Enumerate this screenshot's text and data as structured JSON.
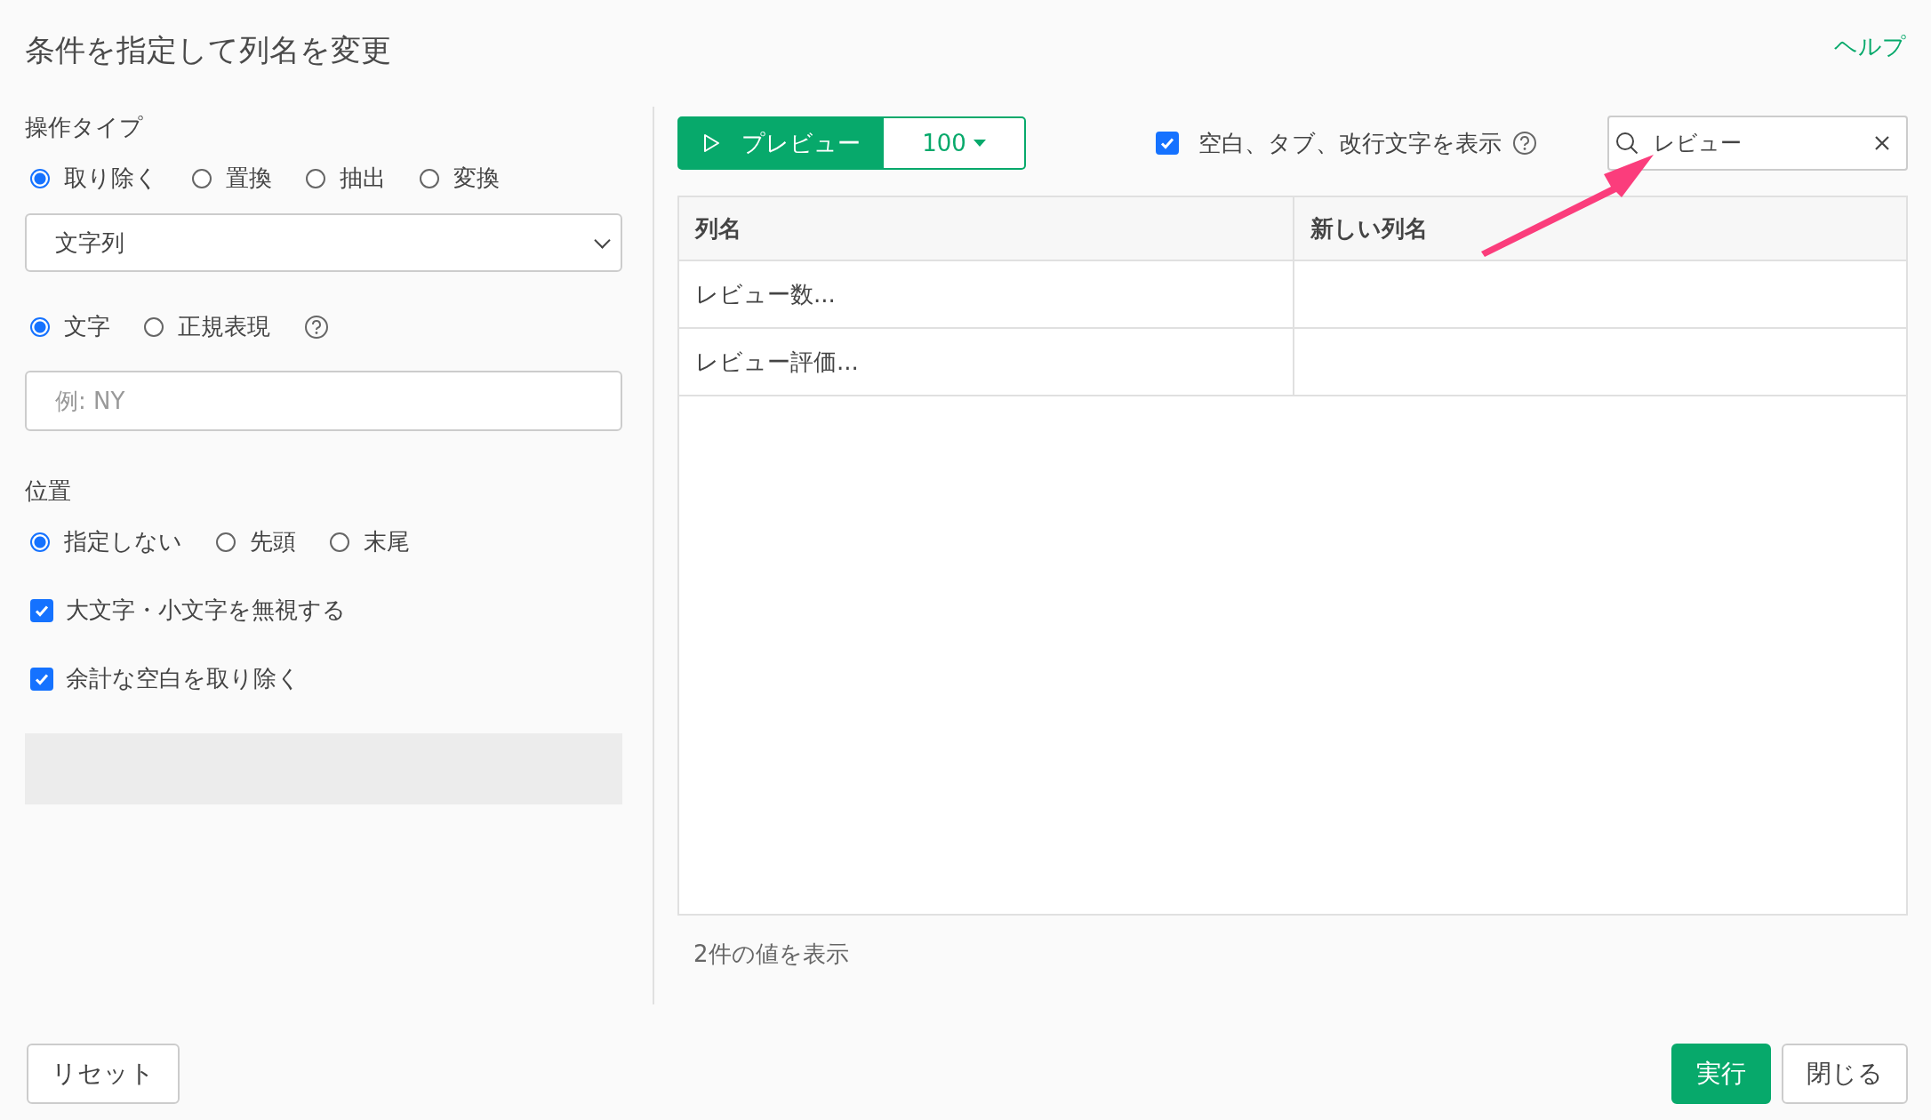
{
  "dialog": {
    "title": "条件を指定して列名を変更",
    "help_link": "ヘルプ"
  },
  "operation_type": {
    "label": "操作タイプ",
    "options": [
      {
        "label": "取り除く",
        "selected": true
      },
      {
        "label": "置換",
        "selected": false
      },
      {
        "label": "抽出",
        "selected": false
      },
      {
        "label": "変換",
        "selected": false
      }
    ]
  },
  "data_type_select": {
    "value": "文字列"
  },
  "match_mode": {
    "options": [
      {
        "label": "文字",
        "selected": true
      },
      {
        "label": "正規表現",
        "selected": false
      }
    ]
  },
  "pattern_input": {
    "placeholder": "例: NY"
  },
  "position": {
    "label": "位置",
    "options": [
      {
        "label": "指定しない",
        "selected": true
      },
      {
        "label": "先頭",
        "selected": false
      },
      {
        "label": "末尾",
        "selected": false
      }
    ]
  },
  "options": [
    {
      "label": "大文字・小文字を無視する",
      "checked": true
    },
    {
      "label": "余計な空白を取り除く",
      "checked": true
    }
  ],
  "preview": {
    "button": "プレビュー",
    "row_count": "100"
  },
  "show_whitespace": {
    "label": "空白、タブ、改行文字を表示",
    "checked": true
  },
  "search": {
    "value": "レビュー"
  },
  "table": {
    "columns": [
      "列名",
      "新しい列名"
    ],
    "rows": [
      {
        "column_name": "レビュー数..."
      },
      {
        "column_name": "レビュー評価..."
      }
    ]
  },
  "result_count": "2件の値を表示",
  "buttons": {
    "reset": "リセット",
    "run": "実行",
    "close": "閉じる"
  }
}
